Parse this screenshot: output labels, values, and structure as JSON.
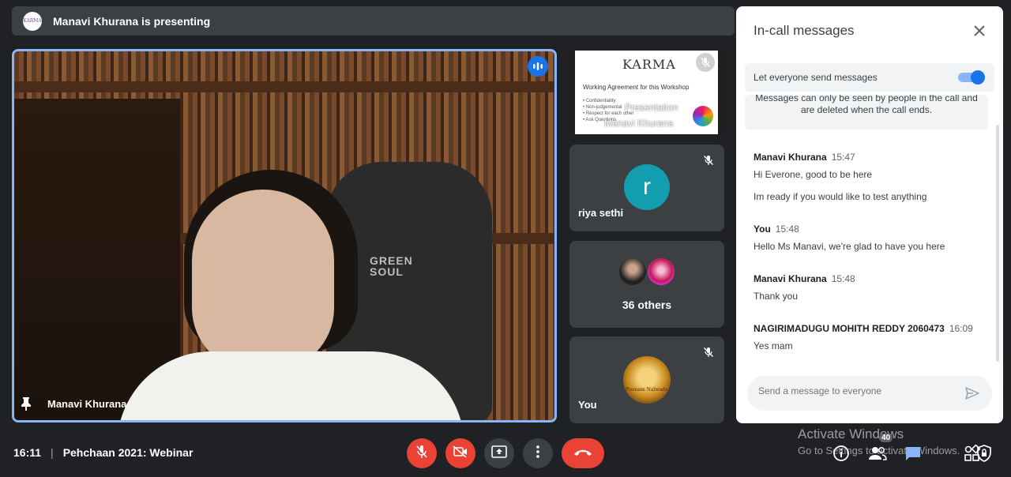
{
  "banner": {
    "logo_text": "KARMA",
    "text": "Manavi Khurana is presenting"
  },
  "main_tile": {
    "name": "Manavi Khurana",
    "chair_brand_line1": "GREEN",
    "chair_brand_line2": "SOUL"
  },
  "side_tiles": {
    "presentation": {
      "slide_brand": "KARMA",
      "slide_heading": "Working Agreement for this Workshop",
      "slide_bullets": [
        "• Confidentiality",
        "• Non-judgemental",
        "• Respect for each other",
        "• Ask Questions"
      ],
      "overlay_line1": "Presentation",
      "overlay_line2": "Manavi Khurana"
    },
    "riya": {
      "initial": "r",
      "name": "riya sethi"
    },
    "others": {
      "label": "36 others"
    },
    "you": {
      "name": "You",
      "avatar_text": "Poonam Nalwade"
    }
  },
  "chat": {
    "title": "In-call messages",
    "setting_label": "Let everyone send messages",
    "setting_enabled": true,
    "notice_line1": "Messages can only be seen by people in the call and",
    "notice_line2": "are deleted when the call ends.",
    "messages": [
      {
        "sender": "Manavi Khurana",
        "time": "15:47",
        "lines": [
          "Hi Everone, good to be here",
          "Im ready if you would like to test anything"
        ]
      },
      {
        "sender": "You",
        "time": "15:48",
        "lines": [
          "Hello Ms Manavi, we're glad to have you here"
        ]
      },
      {
        "sender": "Manavi Khurana",
        "time": "15:48",
        "lines": [
          "Thank you"
        ]
      },
      {
        "sender": "NAGIRIMADUGU MOHITH REDDY 2060473",
        "time": "16:09",
        "lines": [
          "Yes mam"
        ]
      }
    ],
    "compose_placeholder": "Send a message to everyone"
  },
  "bottom_bar": {
    "time": "16:11",
    "separator": "|",
    "meeting_name": "Pehchaan 2021: Webinar",
    "participant_count": "40"
  },
  "watermark": {
    "line1": "Activate Windows",
    "line2": "Go to Settings to activate Windows."
  },
  "colors": {
    "accent": "#8ab4f8",
    "end_call": "#ea4335",
    "toggle": "#1a73e8",
    "avatar_r": "#129eaf"
  },
  "icons": [
    "pin-icon",
    "speaking-icon",
    "mic-off-icon",
    "camera-off-icon",
    "present-icon",
    "more-icon",
    "end-call-icon",
    "info-icon",
    "people-icon",
    "chat-icon",
    "activities-icon",
    "lock-icon",
    "close-icon",
    "send-icon"
  ]
}
